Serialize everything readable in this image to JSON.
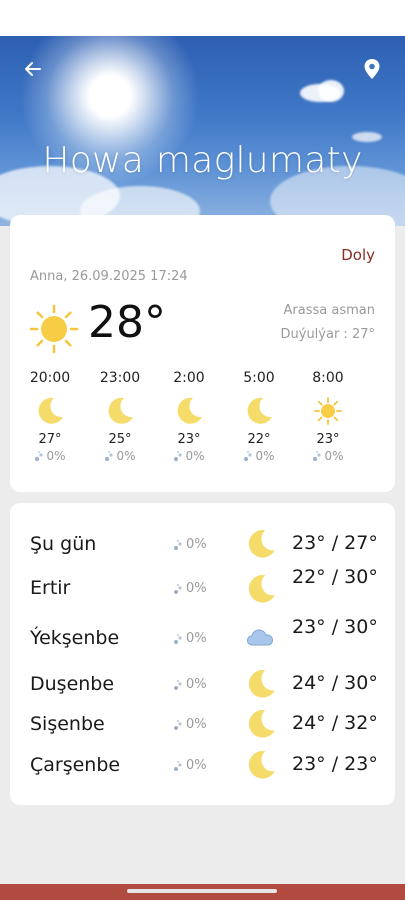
{
  "header": {
    "title": "Howa maglumaty"
  },
  "current": {
    "full_link": "Doly",
    "datetime": "Anna, 26.09.2025  17:24",
    "temperature": "28°",
    "condition": "Arassa asman",
    "feels_like": "Duýulýar : 27°",
    "icon": "sun-icon"
  },
  "hourly": [
    {
      "time": "20:00",
      "icon": "moon-icon",
      "temp": "27°",
      "precip": "0%"
    },
    {
      "time": "23:00",
      "icon": "moon-icon",
      "temp": "25°",
      "precip": "0%"
    },
    {
      "time": "2:00",
      "icon": "moon-icon",
      "temp": "23°",
      "precip": "0%"
    },
    {
      "time": "5:00",
      "icon": "moon-icon",
      "temp": "22°",
      "precip": "0%"
    },
    {
      "time": "8:00",
      "icon": "sun-icon",
      "temp": "23°",
      "precip": "0%"
    }
  ],
  "daily": [
    {
      "day": "Şu gün",
      "precip": "0%",
      "icon": "moon-icon",
      "temp": "23° / 27°"
    },
    {
      "day": "Ertir",
      "precip": "0%",
      "icon": "moon-icon",
      "temp": "22° / 30°"
    },
    {
      "day": "Ýekşenbe",
      "precip": "0%",
      "icon": "cloud-icon",
      "temp": "23° / 30°"
    },
    {
      "day": "Duşenbe",
      "precip": "0%",
      "icon": "moon-icon",
      "temp": "24° / 30°"
    },
    {
      "day": "Sişenbe",
      "precip": "0%",
      "icon": "moon-icon",
      "temp": "24° / 32°"
    },
    {
      "day": "Çarşenbe",
      "precip": "0%",
      "icon": "moon-icon",
      "temp": "23° / 23°"
    }
  ],
  "colors": {
    "accent": "#8b2b22",
    "icon_yellow": "#f5d55a",
    "bottom_bar": "#b24b3f"
  }
}
